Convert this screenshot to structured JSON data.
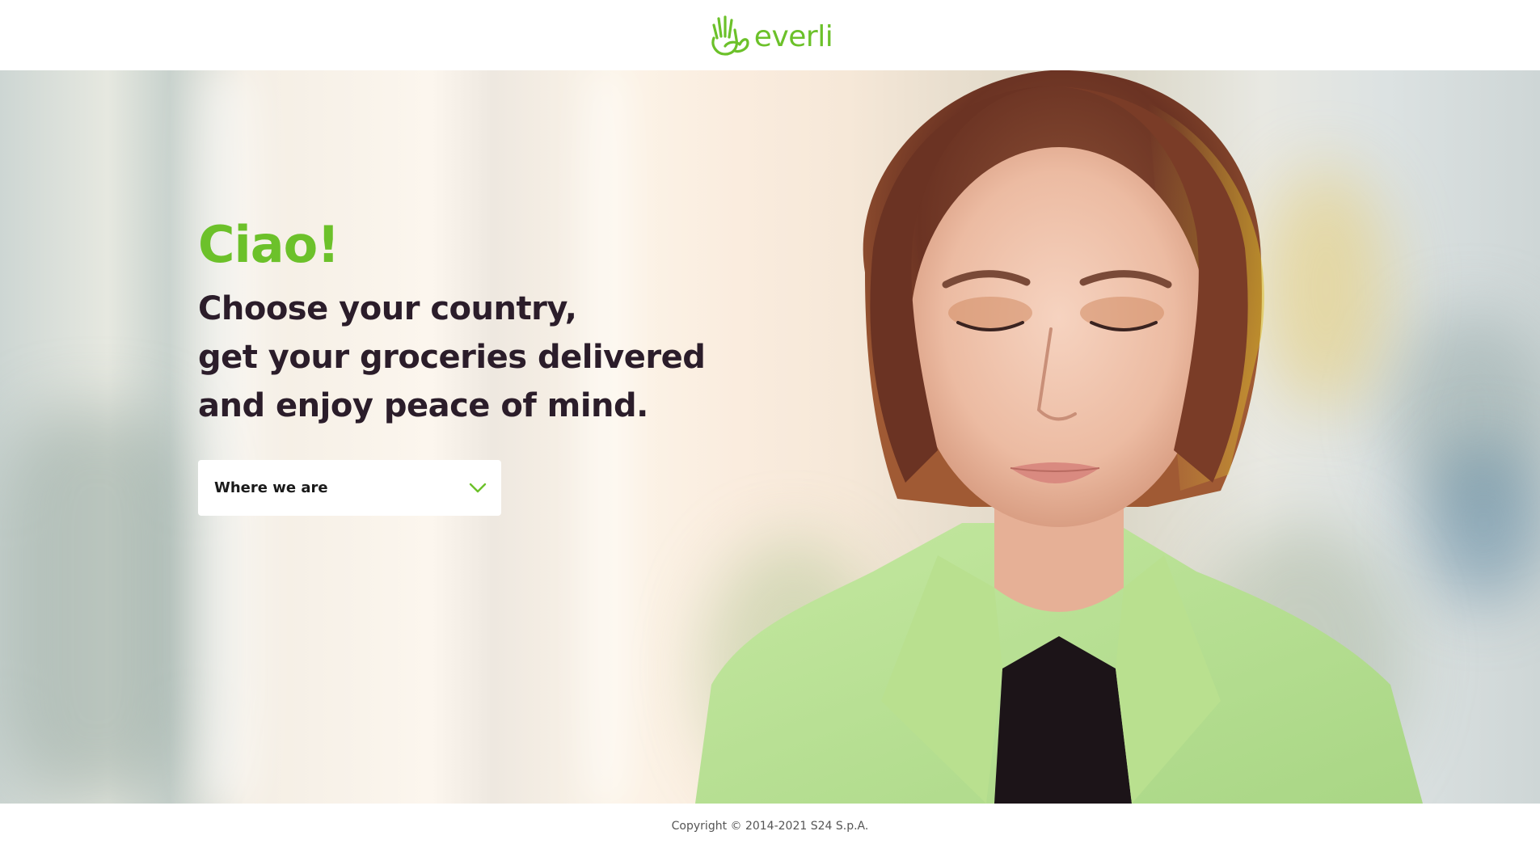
{
  "header": {
    "logo_text": "everli"
  },
  "hero": {
    "greeting": "Ciao!",
    "headline": [
      "Choose your country,",
      "get your groceries delivered",
      "and enjoy peace of mind."
    ],
    "country_select": {
      "label": "Where we are",
      "icon": "chevron-down-icon"
    },
    "image": "woman-portrait"
  },
  "footer": {
    "copyright": "Copyright © 2014-2021 S24 S.p.A."
  },
  "colors": {
    "brand_green": "#6cc12a",
    "headline": "#2b1d2a",
    "background": "#ffffff"
  }
}
